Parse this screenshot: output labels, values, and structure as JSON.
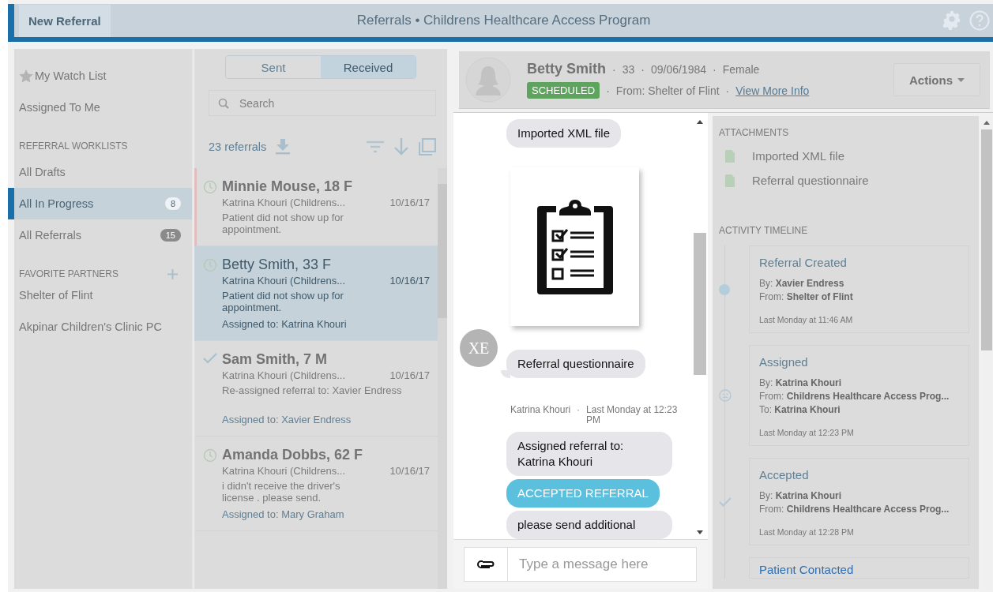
{
  "header": {
    "new_button": "New Referral",
    "title": "Referrals • Childrens Healthcare Access Program"
  },
  "sidebar": {
    "watch_list": "My Watch List",
    "assigned": "Assigned To Me",
    "worklists_heading": "REFERRAL WORKLISTS",
    "worklists": [
      {
        "label": "All Drafts",
        "selected": false
      },
      {
        "label": "All In Progress",
        "count": "8",
        "selected": true
      },
      {
        "label": "All Referrals",
        "count": "15",
        "selected": false
      }
    ],
    "partners_heading": "FAVORITE PARTNERS",
    "partners": [
      "Shelter of Flint",
      "Akpinar Children's Clinic PC"
    ]
  },
  "list": {
    "tabs": [
      {
        "label": "Sent",
        "selected": false
      },
      {
        "label": "Received",
        "selected": true
      }
    ],
    "search": {
      "placeholder": "Search"
    },
    "count": "23 referrals",
    "items": [
      {
        "kind": "pending",
        "name": "Minnie Mouse, 18 F",
        "from": "Katrina Khouri (Childrens...",
        "date": "10/16/17",
        "note": "Patient did not show up for appointment.",
        "flagged": true,
        "selected": false
      },
      {
        "kind": "pending",
        "name": "Betty Smith, 33 F",
        "from": "Katrina Khouri (Childrens...",
        "date": "10/16/17",
        "note": "Patient did not show up for appointment.",
        "assigned": "Assigned to: Katrina Khouri",
        "flagged": false,
        "selected": true
      },
      {
        "kind": "accepted",
        "name": "Sam Smith, 7 M",
        "from": "Katrina Khouri (Childrens...",
        "date": "10/16/17",
        "note": "Re-assigned referral to: Xavier Endress",
        "assigned": "Assigned to: Xavier Endress",
        "flagged": false,
        "selected": false
      },
      {
        "kind": "pending",
        "name": "Amanda Dobbs, 62 F",
        "from": "Katrina Khouri (Childrens...",
        "date": "10/16/17",
        "note": "i didn't receive the driver's license . please send.",
        "assigned": "Assigned to: Mary Graham",
        "flagged": false,
        "selected": false
      }
    ]
  },
  "patient": {
    "name": "Betty Smith",
    "separator": "·",
    "age": "33",
    "dob": "09/06/1984",
    "sex": "Female",
    "status": "SCHEDULED",
    "from": "From: Shelter of Flint",
    "link": "View More Info",
    "actions": "Actions"
  },
  "chat": {
    "messages": [
      {
        "kind": "attachment",
        "text": "Imported XML file"
      },
      {
        "kind": "image"
      },
      {
        "kind": "attachment",
        "text": "Referral questionnaire",
        "avatar": "XE"
      },
      {
        "kind": "meta",
        "author": "Katrina Khouri",
        "separator": "·",
        "time": "Last Monday at 12:23 PM"
      },
      {
        "kind": "text",
        "text": "Assigned referral to: Katrina Khouri"
      },
      {
        "kind": "event",
        "text": "ACCEPTED REFERRAL"
      },
      {
        "kind": "text",
        "text": "please send additional"
      }
    ],
    "placeholder": "Type a message here"
  },
  "details": {
    "attachments_heading": "ATTACHMENTS",
    "attachments": [
      "Imported XML file",
      "Referral questionnaire"
    ],
    "timeline_heading": "ACTIVITY TIMELINE",
    "events": [
      {
        "kind": "created",
        "title": "Referral Created",
        "lines": [
          "By: **Xavier Endress**",
          "From: **Shelter of Flint**"
        ],
        "time": "Last Monday at 11:46 AM"
      },
      {
        "kind": "assigned",
        "title": "Assigned",
        "lines": [
          "By: **Katrina Khouri**",
          "From: **Childrens Healthcare Access Prog...**",
          "To: **Katrina Khouri**"
        ],
        "time": "Last Monday at 12:23 PM"
      },
      {
        "kind": "accepted",
        "title": "Accepted",
        "lines": [
          "By: **Katrina Khouri**",
          "From: **Childrens Healthcare Access Prog...**"
        ],
        "time": "Last Monday at 12:28 PM"
      },
      {
        "kind": "contacted",
        "title": "Patient Contacted"
      }
    ]
  }
}
